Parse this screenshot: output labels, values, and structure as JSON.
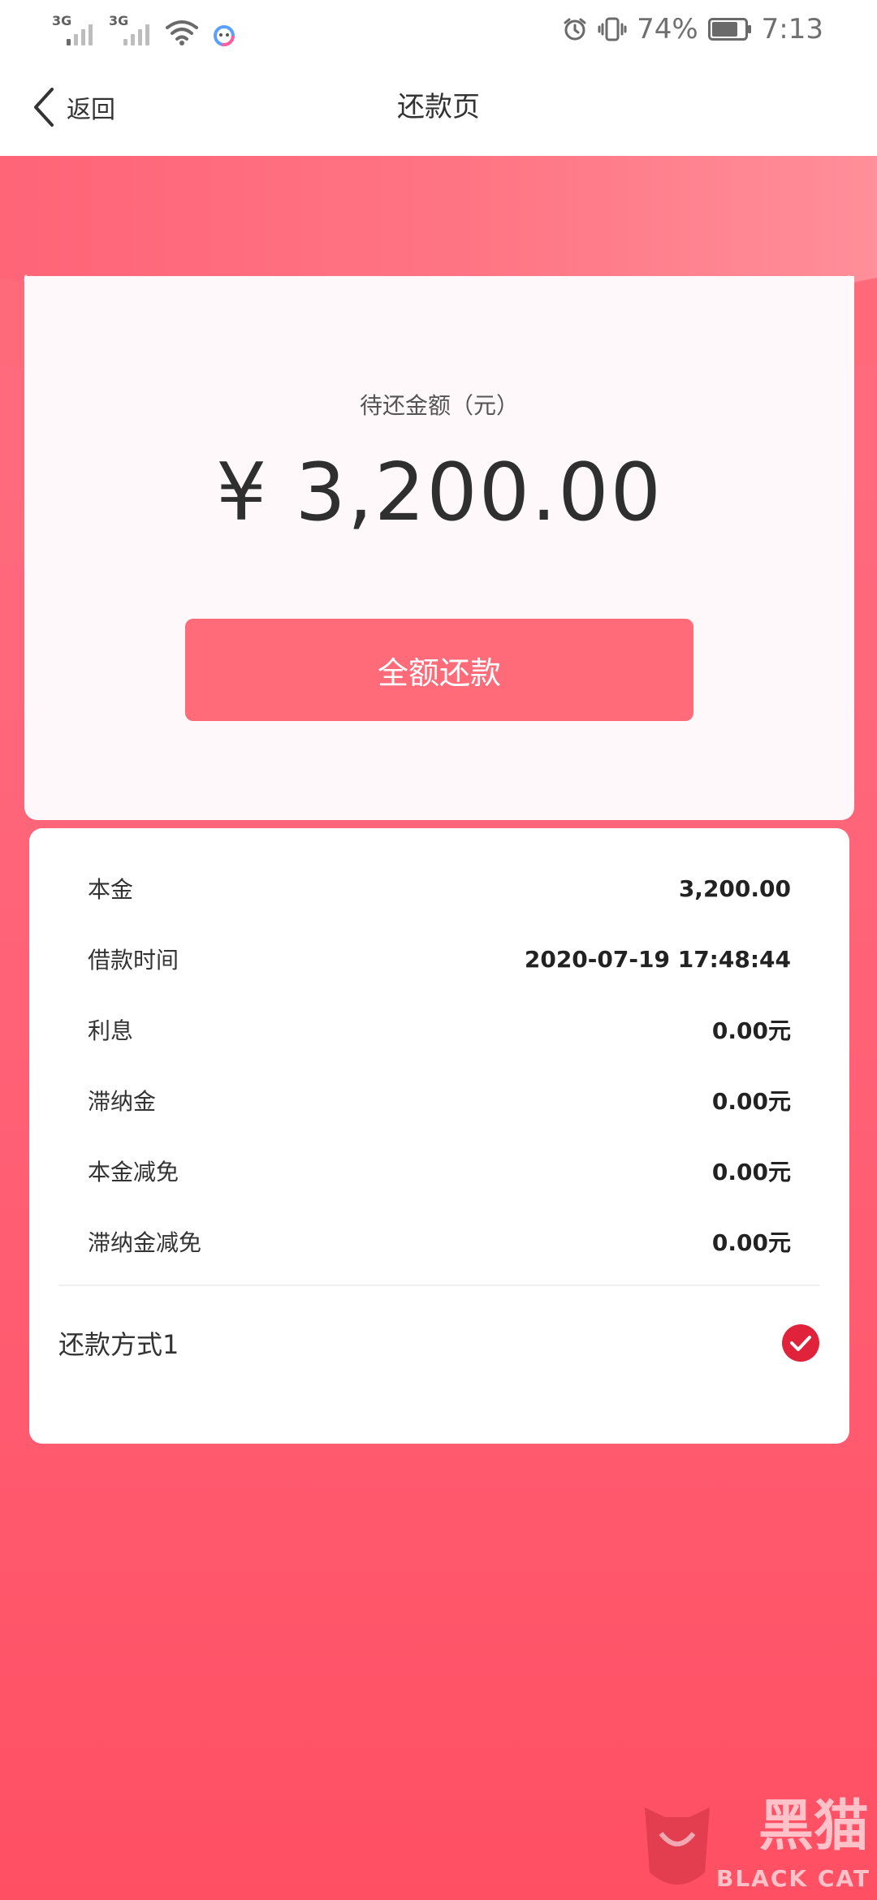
{
  "status_bar": {
    "network_1": "3G",
    "network_2": "3G",
    "battery_percent": "74%",
    "time": "7:13",
    "icons": [
      "signal-3g-icon",
      "signal-3g-icon",
      "wifi-icon",
      "app-notification-icon",
      "alarm-icon",
      "vibrate-icon",
      "battery-icon"
    ]
  },
  "header": {
    "back_label": "返回",
    "title": "还款页"
  },
  "amount_card": {
    "label": "待还金额（元）",
    "amount": "¥ 3,200.00",
    "pay_full_button": "全额还款"
  },
  "details": {
    "rows": [
      {
        "label": "本金",
        "value": "3,200.00"
      },
      {
        "label": "借款时间",
        "value": "2020-07-19 17:48:44"
      },
      {
        "label": "利息",
        "value": "0.00元"
      },
      {
        "label": "滞纳金",
        "value": "0.00元"
      },
      {
        "label": "本金减免",
        "value": "0.00元"
      },
      {
        "label": "滞纳金减免",
        "value": "0.00元"
      }
    ],
    "payment_method": {
      "label": "还款方式1",
      "selected": true
    }
  },
  "watermark": {
    "cn": "黑猫",
    "en": "BLACK CAT"
  },
  "colors": {
    "accent": "#ff6b79",
    "background_gradient_top": "#ff7080",
    "background_gradient_bottom": "#ff4f63",
    "check_red": "#e0223a"
  }
}
